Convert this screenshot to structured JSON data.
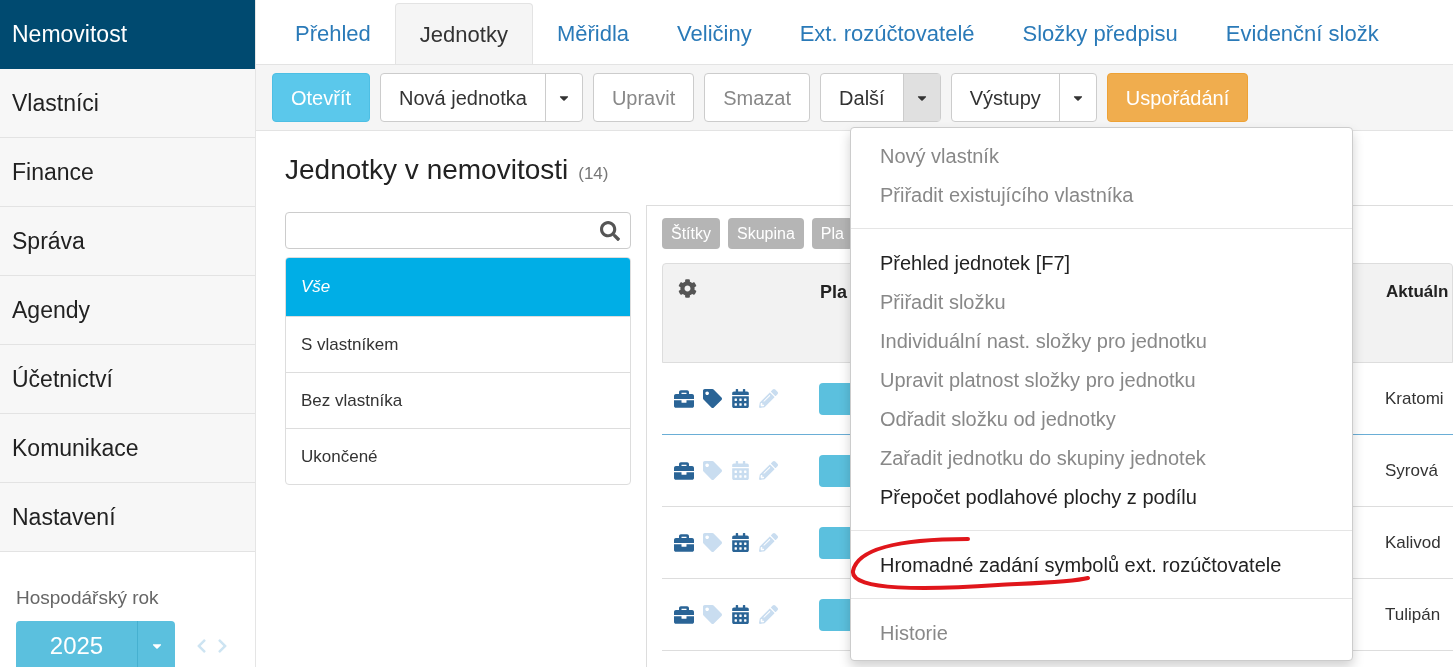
{
  "sidebar": {
    "items": [
      {
        "label": "Nemovitost",
        "selected": true
      },
      {
        "label": "Vlastníci",
        "selected": false
      },
      {
        "label": "Finance",
        "selected": false
      },
      {
        "label": "Správa",
        "selected": false
      },
      {
        "label": "Agendy",
        "selected": false
      },
      {
        "label": "Účetnictví",
        "selected": false
      },
      {
        "label": "Komunikace",
        "selected": false
      },
      {
        "label": "Nastavení",
        "selected": false
      }
    ],
    "year_label": "Hospodářský rok",
    "year": "2025"
  },
  "tabs": [
    {
      "label": "Přehled",
      "selected": false
    },
    {
      "label": "Jednotky",
      "selected": true
    },
    {
      "label": "Měřidla",
      "selected": false
    },
    {
      "label": "Veličiny",
      "selected": false
    },
    {
      "label": "Ext. rozúčtovatelé",
      "selected": false
    },
    {
      "label": "Složky předpisu",
      "selected": false
    },
    {
      "label": "Evidenční složk",
      "selected": false
    }
  ],
  "toolbar": [
    {
      "label": "Otevřít",
      "kind": "primary",
      "split": false,
      "disabled": false
    },
    {
      "label": "Nová jednotka",
      "kind": "default",
      "split": true,
      "disabled": false,
      "expanded": false
    },
    {
      "label": "Upravit",
      "kind": "default",
      "split": false,
      "disabled": true
    },
    {
      "label": "Smazat",
      "kind": "default",
      "split": false,
      "disabled": true
    },
    {
      "label": "Další",
      "kind": "default",
      "split": true,
      "disabled": false,
      "expanded": true
    },
    {
      "label": "Výstupy",
      "kind": "default",
      "split": true,
      "disabled": false,
      "expanded": false
    },
    {
      "label": "Uspořádání",
      "kind": "warning",
      "split": false,
      "disabled": false
    }
  ],
  "title": "Jednotky v nemovitosti",
  "count": "(14)",
  "filters": [
    {
      "label": "Vše",
      "selected": true
    },
    {
      "label": "S vlastníkem",
      "selected": false
    },
    {
      "label": "Bez vlastníka",
      "selected": false
    },
    {
      "label": "Ukončené",
      "selected": false
    }
  ],
  "tags": [
    "Štítky",
    "Skupina",
    "Pla"
  ],
  "table": {
    "columns": [
      "Pla",
      "Aktuáln"
    ],
    "rows": [
      {
        "tag": true,
        "calendar": true,
        "selected": true,
        "column_3": "Kratomi"
      },
      {
        "tag": false,
        "calendar": false,
        "selected": false,
        "column_3": "Syrová"
      },
      {
        "tag": false,
        "calendar": true,
        "selected": false,
        "column_3": "Kalivod"
      },
      {
        "tag": false,
        "calendar": true,
        "selected": false,
        "column_3": "Tulipán"
      }
    ]
  },
  "menu": {
    "sections": [
      [
        {
          "label": "Nový vlastník",
          "disabled": true
        },
        {
          "label": "Přiřadit existujícího vlastníka",
          "disabled": true
        }
      ],
      [
        {
          "label": "Přehled jednotek [F7]",
          "disabled": false
        },
        {
          "label": "Přiřadit složku",
          "disabled": true
        },
        {
          "label": "Individuální nast. složky pro jednotku",
          "disabled": true
        },
        {
          "label": "Upravit platnost složky pro jednotku",
          "disabled": true
        },
        {
          "label": "Odřadit složku od jednotky",
          "disabled": true
        },
        {
          "label": "Zařadit jednotku do skupiny jednotek",
          "disabled": true
        },
        {
          "label": "Přepočet podlahové plochy z podílu",
          "disabled": false
        }
      ],
      [
        {
          "label": "Hromadné zadání symbolů ext. rozúčtovatele",
          "disabled": false
        }
      ],
      [
        {
          "label": "Historie",
          "disabled": true
        }
      ]
    ]
  }
}
